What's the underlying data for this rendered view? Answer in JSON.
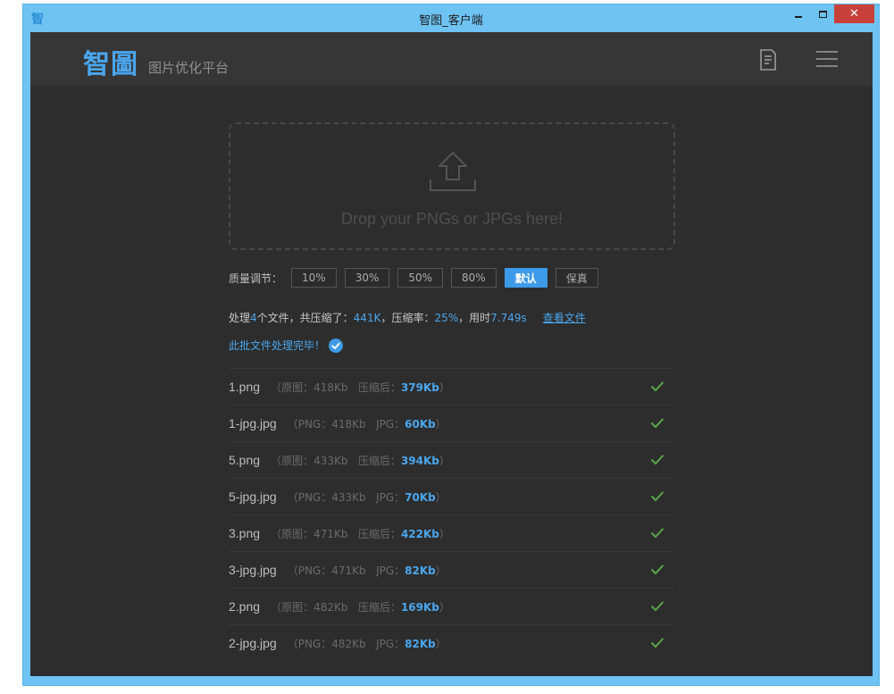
{
  "window": {
    "title": "智图_客户端",
    "icon_glyph": "智",
    "close_glyph": "✕"
  },
  "header": {
    "logo": "智圖",
    "subtitle": "图片优化平台",
    "icons": [
      "document-icon",
      "menu-icon"
    ]
  },
  "dropzone": {
    "text": "Drop your PNGs or JPGs here!",
    "icon": "upload-icon"
  },
  "quality": {
    "label": "质量调节：",
    "options": [
      "10%",
      "30%",
      "50%",
      "80%",
      "默认",
      "保真"
    ],
    "selected": "默认"
  },
  "summary": {
    "prefix": "处理",
    "file_count": "4",
    "count_suffix": "个文件，共压缩了：",
    "saved": "441K",
    "rate_label": "，压缩率：",
    "rate": "25%",
    "time_label": "，用时",
    "time": "7.749s",
    "view_link": "查看文件"
  },
  "done_message": "此批文件处理完毕！",
  "files": [
    {
      "name": "1.png",
      "open": "（",
      "orig_label": "原图：",
      "orig": "418Kb",
      "new_label": "压缩后：",
      "new": "379Kb",
      "close": "）"
    },
    {
      "name": "1-jpg.jpg",
      "open": "（",
      "orig_label": "PNG：",
      "orig": "418Kb",
      "new_label": "JPG：",
      "new": "60Kb",
      "close": "）"
    },
    {
      "name": "5.png",
      "open": "（",
      "orig_label": "原图：",
      "orig": "433Kb",
      "new_label": "压缩后：",
      "new": "394Kb",
      "close": "）"
    },
    {
      "name": "5-jpg.jpg",
      "open": "（",
      "orig_label": "PNG：",
      "orig": "433Kb",
      "new_label": "JPG：",
      "new": "70Kb",
      "close": "）"
    },
    {
      "name": "3.png",
      "open": "（",
      "orig_label": "原图：",
      "orig": "471Kb",
      "new_label": "压缩后：",
      "new": "422Kb",
      "close": "）"
    },
    {
      "name": "3-jpg.jpg",
      "open": "（",
      "orig_label": "PNG：",
      "orig": "471Kb",
      "new_label": "JPG：",
      "new": "82Kb",
      "close": "）"
    },
    {
      "name": "2.png",
      "open": "（",
      "orig_label": "原图：",
      "orig": "482Kb",
      "new_label": "压缩后：",
      "new": "169Kb",
      "close": "）"
    },
    {
      "name": "2-jpg.jpg",
      "open": "（",
      "orig_label": "PNG：",
      "orig": "482Kb",
      "new_label": "JPG：",
      "new": "82Kb",
      "close": "）"
    }
  ],
  "colors": {
    "accent": "#4aa6ee",
    "check": "#5aa34a",
    "background": "#2d2d2d",
    "header": "#363636",
    "titlebar": "#6ec3f3",
    "close_button": "#c7413a"
  }
}
